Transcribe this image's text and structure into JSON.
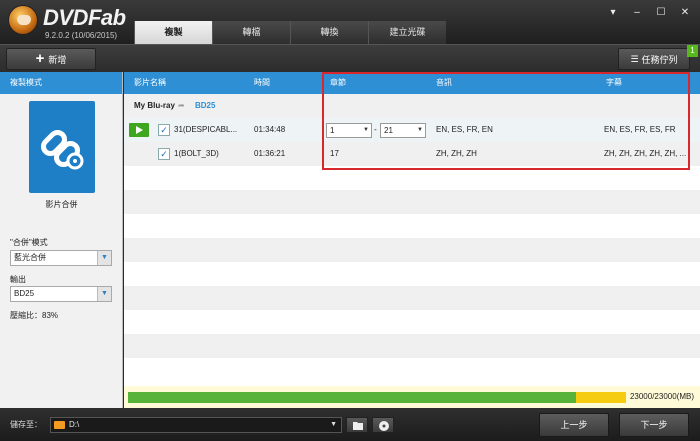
{
  "app": {
    "name": "DVDFab",
    "version": "9.2.0.2 (10/06/2015)",
    "window_controls": [
      "▾",
      "–",
      "☐",
      "✕"
    ]
  },
  "tabs": [
    {
      "label": "複製",
      "active": true
    },
    {
      "label": "轉檔",
      "active": false
    },
    {
      "label": "轉換",
      "active": false
    },
    {
      "label": "建立光碟",
      "active": false
    }
  ],
  "toolbar": {
    "add_label": "新增",
    "queue_label": "任務佇列",
    "queue_count": "1"
  },
  "left_panel": {
    "header": "複製模式",
    "mode_name": "影片合併",
    "merge_mode_label": "\"合併\"模式",
    "merge_mode_value": "藍光合併",
    "output_label": "輸出",
    "output_value": "BD25",
    "compression": "壓縮比：83%"
  },
  "table": {
    "headers": {
      "title": "影片名稱",
      "runtime": "時間",
      "chapter": "章節",
      "audio": "音訊",
      "subtitle": "字幕"
    },
    "source": {
      "name": "My Blu-ray",
      "target": "BD25"
    },
    "rows": [
      {
        "checked": true,
        "playable": true,
        "title": "31(DESPICABL...",
        "runtime": "01:34:48",
        "chapter_from": "1",
        "chapter_to": "21",
        "audio": "EN, ES, FR, EN",
        "subtitle": "EN, ES, FR, ES, FR"
      },
      {
        "checked": true,
        "playable": false,
        "title": "1(BOLT_3D)",
        "runtime": "01:36:21",
        "chapter": "17",
        "audio": "ZH, ZH, ZH",
        "subtitle": "ZH, ZH, ZH, ZH, ZH, ..."
      }
    ]
  },
  "progress": {
    "text": "23000/23000(MB)",
    "used_fraction": 0.9,
    "overflow_fraction": 0.1,
    "colors": {
      "used": "#57b33a",
      "extra": "#f6cc10"
    }
  },
  "bottom": {
    "save_label": "儲存至：",
    "path": "D:\\",
    "back_label": "上一步",
    "next_label": "下一步"
  },
  "colors": {
    "accent": "#2e8fd4",
    "highlight": "#d8282d",
    "play": "#3fa61f"
  }
}
